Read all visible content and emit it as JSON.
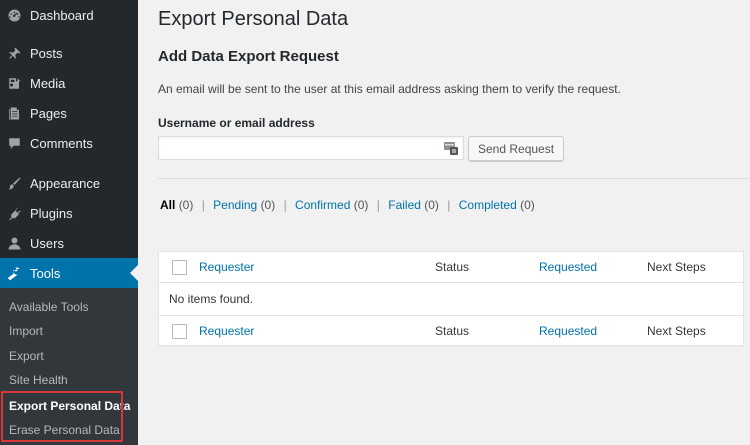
{
  "sidebar": {
    "items": [
      {
        "label": "Dashboard",
        "icon": "dashboard-icon"
      },
      {
        "label": "Posts",
        "icon": "pin-icon"
      },
      {
        "label": "Media",
        "icon": "media-icon"
      },
      {
        "label": "Pages",
        "icon": "pages-icon"
      },
      {
        "label": "Comments",
        "icon": "comment-icon"
      },
      {
        "label": "Appearance",
        "icon": "paintbrush-icon"
      },
      {
        "label": "Plugins",
        "icon": "plug-icon"
      },
      {
        "label": "Users",
        "icon": "user-icon"
      },
      {
        "label": "Tools",
        "icon": "wrench-icon"
      }
    ],
    "submenu": [
      {
        "label": "Available Tools"
      },
      {
        "label": "Import"
      },
      {
        "label": "Export"
      },
      {
        "label": "Site Health"
      },
      {
        "label": "Export Personal Data"
      },
      {
        "label": "Erase Personal Data"
      }
    ],
    "active_color": "#0073aa",
    "highlight_color": "#d63638"
  },
  "main": {
    "page_title": "Export Personal Data",
    "section_title": "Add Data Export Request",
    "description": "An email will be sent to the user at this email address asking them to verify the request.",
    "field_label": "Username or email address",
    "field_value": "",
    "send_button": "Send Request",
    "filters": [
      {
        "label": "All",
        "count": "(0)"
      },
      {
        "label": "Pending",
        "count": "(0)"
      },
      {
        "label": "Confirmed",
        "count": "(0)"
      },
      {
        "label": "Failed",
        "count": "(0)"
      },
      {
        "label": "Completed",
        "count": "(0)"
      }
    ],
    "filter_separator": "|",
    "table": {
      "columns": [
        "Requester",
        "Status",
        "Requested",
        "Next Steps"
      ],
      "empty_message": "No items found."
    }
  }
}
